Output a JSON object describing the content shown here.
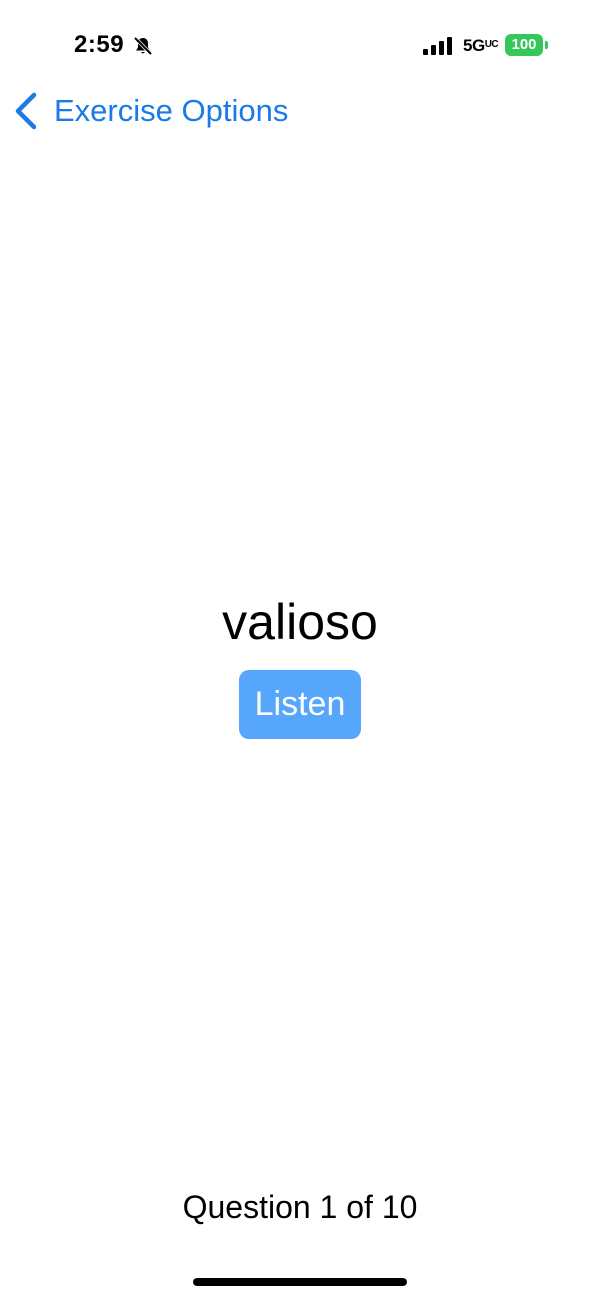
{
  "status_bar": {
    "time": "2:59",
    "network": "5G",
    "network_suffix": "UC",
    "battery": "100",
    "icons": {
      "silent": "bell-slash-icon",
      "signal": "cellular-signal-icon"
    }
  },
  "nav": {
    "back_label": "Exercise Options",
    "back_icon": "chevron-left-icon"
  },
  "exercise": {
    "word": "valioso",
    "listen_label": "Listen",
    "progress_text": "Question 1 of 10"
  },
  "colors": {
    "accent": "#1a7ae6",
    "button": "#56a6fb",
    "battery": "#34c759"
  }
}
